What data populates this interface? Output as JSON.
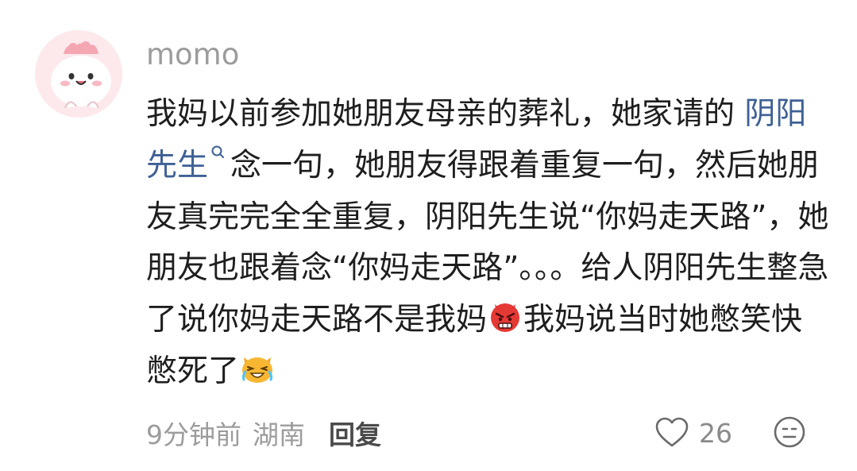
{
  "comment": {
    "username": "momo",
    "text_part1": "我妈以前参加她朋友母亲的葬礼，她家请的 ",
    "link_text": "阴阳先生",
    "text_part2": "念一句，她朋友得跟着重复一句，然后她朋友真完完全全重复，阴阳先生说“你妈走天路”，她朋友也跟着念“你妈走天路”。。。给人阴阳先生整急了说你妈走天路不是我妈",
    "text_part3": "我妈说当时她憋笑快憋死了",
    "emoji_1": "angry-face-emoji",
    "emoji_2": "crying-laughing-cat-emoji",
    "time": "9分钟前",
    "location": "湖南",
    "reply_label": "回复",
    "like_count": "26"
  },
  "colors": {
    "text": "#1e1e1e",
    "meta": "#9c9c9c",
    "link": "#3e6095",
    "avatar_bg": "#fde9ec"
  }
}
